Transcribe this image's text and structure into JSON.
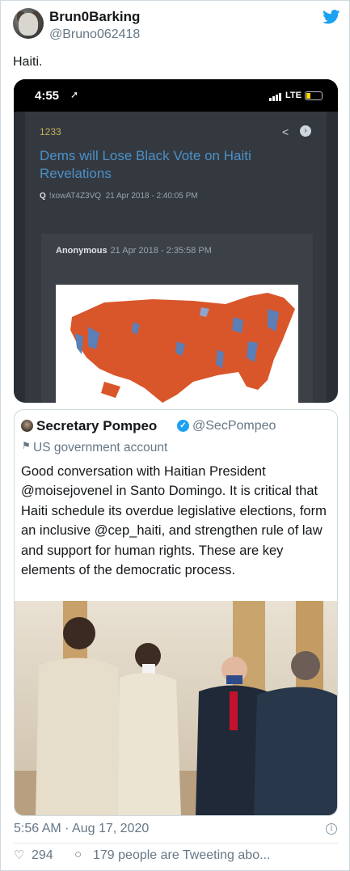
{
  "tweet": {
    "display_name": "Brun0Barking",
    "handle": "@Bruno062418",
    "text": "Haiti."
  },
  "embedded_screenshot": {
    "status_bar": {
      "time": "4:55",
      "network": "LTE"
    },
    "post": {
      "number": "1233",
      "title": "Dems will Lose Black Vote on Haiti Revelations",
      "trip_prefix": "Q",
      "trip": "!xowAT4Z3VQ",
      "date": "21 Apr 2018 - 2:40:05 PM"
    },
    "reply": {
      "author": "Anonymous",
      "date": "21 Apr 2018 - 2:35:58 PM"
    },
    "map_colors": {
      "land": "#d9562b",
      "alt": "#5b7fb6"
    }
  },
  "quoted_tweet": {
    "display_name": "Secretary Pompeo",
    "handle": "@SecPompeo",
    "label": "US government account",
    "text": "Good conversation with Haitian President @moisejovenel in Santo Domingo. It is critical that Haiti schedule its overdue legislative elections, form an inclusive @cep_haiti, and strengthen rule of law and support for human rights. These are key elements of the democratic process."
  },
  "footer": {
    "timestamp": "5:56 AM · Aug 17, 2020",
    "likes": "294",
    "conversation": "179 people are Tweeting abo..."
  },
  "colors": {
    "accent": "#1da1f2",
    "muted": "#657786"
  }
}
